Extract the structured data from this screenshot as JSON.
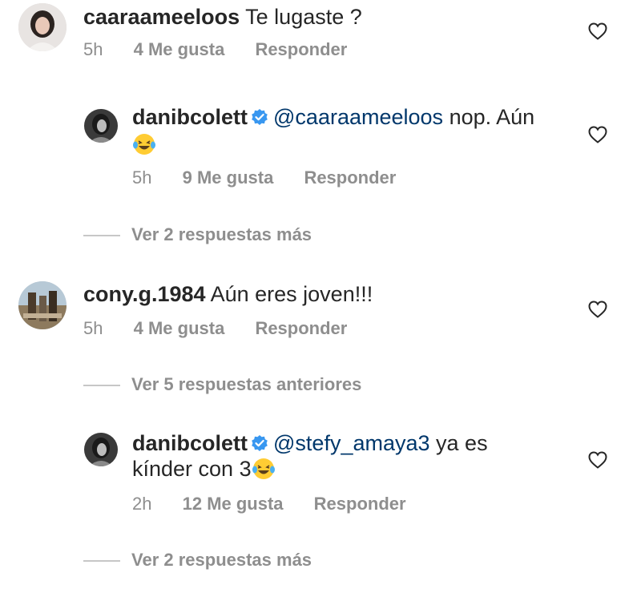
{
  "comments": [
    {
      "username": "caaraameeloos",
      "text": "Te lugaste ?",
      "time": "5h",
      "likes": "4 Me gusta",
      "reply": "Responder"
    },
    {
      "username": "danibcolett",
      "mention": "@caaraameeloos",
      "text": "nop. Aún",
      "emoji": "laughing-tears-emoji",
      "time": "5h",
      "likes": "9 Me gusta",
      "reply": "Responder"
    },
    {
      "username": "cony.g.1984",
      "text": "Aún eres joven!!!",
      "time": "5h",
      "likes": "4 Me gusta",
      "reply": "Responder"
    },
    {
      "username": "danibcolett",
      "mention": "@stefy_amaya3",
      "text": "ya es",
      "text2": "kínder con 3",
      "emoji": "laughing-tears-emoji",
      "time": "2h",
      "likes": "12 Me gusta",
      "reply": "Responder"
    }
  ],
  "view_more": [
    "Ver 2 respuestas más",
    "Ver 5 respuestas anteriores",
    "Ver 2 respuestas más"
  ],
  "icons": {
    "heart": "heart-outline-icon",
    "verified": "verified-badge-icon"
  },
  "colors": {
    "mention": "#00376b",
    "muted": "#8e8e8e",
    "verified": "#3897f0",
    "text": "#262626"
  }
}
